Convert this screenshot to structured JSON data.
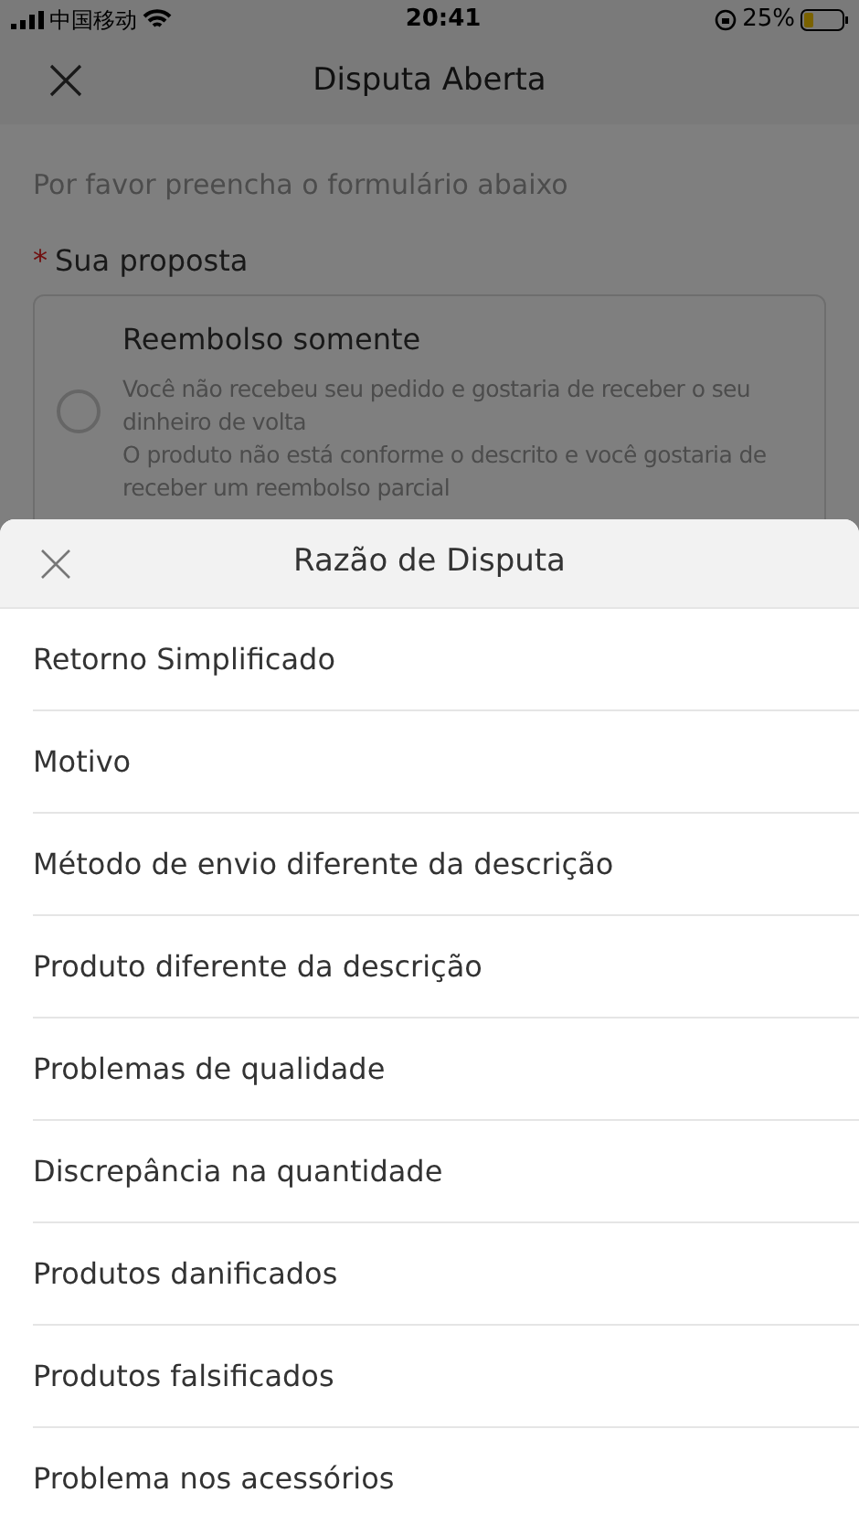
{
  "status_bar": {
    "carrier": "中国移动",
    "time": "20:41",
    "battery": "25%"
  },
  "header": {
    "title": "Disputa Aberta"
  },
  "form": {
    "intro": "Por favor preencha o formulário abaixo",
    "required_mark": "*",
    "label": "Sua proposta",
    "options": [
      {
        "title": "Reembolso somente",
        "selected": false,
        "lines": [
          "Você não recebeu seu pedido e gostaria de receber o seu dinheiro de volta",
          "O produto não está conforme o descrito e você gostaria de receber um reembolso parcial"
        ]
      }
    ]
  },
  "sheet": {
    "title": "Razão de Disputa",
    "items": [
      "Retorno Simplificado",
      "Motivo",
      "Método de envio diferente da descrição",
      "Produto diferente da descrição",
      "Problemas de qualidade",
      "Discrepância na quantidade",
      "Produtos danificados",
      "Produtos falsificados",
      "Problema nos acessórios"
    ]
  }
}
